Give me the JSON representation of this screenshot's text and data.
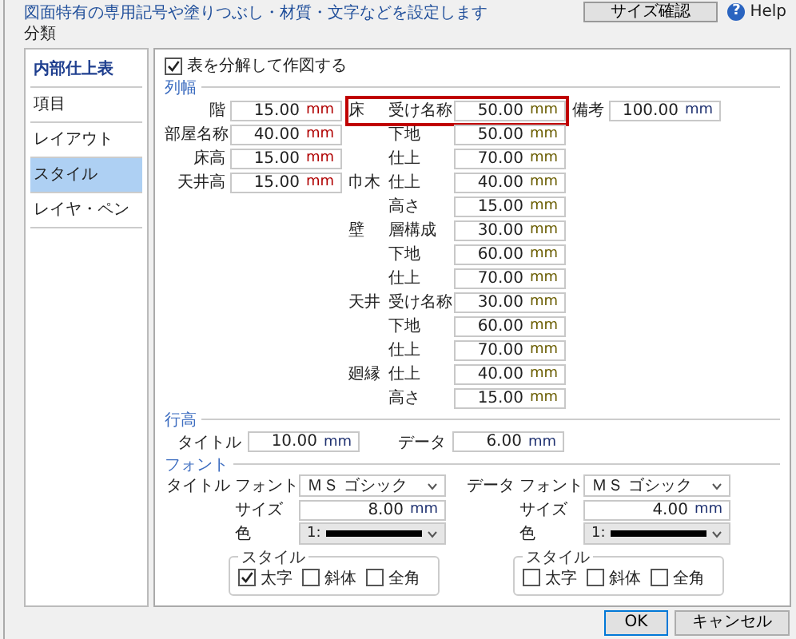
{
  "description": "図面特有の専用記号や塗りつぶし・材質・文字などを設定します",
  "top_button": {
    "label": "サイズ確認"
  },
  "help": {
    "glyph": "?",
    "label": "Help"
  },
  "category_label": "分類",
  "sidebar": {
    "items": [
      {
        "label": "内部仕上表",
        "kind": "header",
        "selected": false
      },
      {
        "label": "項目",
        "kind": "item",
        "selected": false
      },
      {
        "label": "レイアウト",
        "kind": "item",
        "selected": false
      },
      {
        "label": "スタイル",
        "kind": "item",
        "selected": true
      },
      {
        "label": "レイヤ・ペン",
        "kind": "item",
        "selected": false
      }
    ]
  },
  "split_checkbox": {
    "label": "表を分解して作図する",
    "checked": true
  },
  "column_width": {
    "title": "列幅",
    "left": [
      {
        "label": "階",
        "value": "15.00",
        "unit": "mm"
      },
      {
        "label": "部屋名称",
        "value": "40.00",
        "unit": "mm"
      },
      {
        "label": "床高",
        "value": "15.00",
        "unit": "mm"
      },
      {
        "label": "天井高",
        "value": "15.00",
        "unit": "mm"
      }
    ],
    "middle": [
      {
        "group": "床",
        "label": "受け名称",
        "value": "50.00",
        "unit": "mm",
        "highlighted": true
      },
      {
        "label": "下地",
        "value": "50.00",
        "unit": "mm",
        "highlighted": false
      },
      {
        "label": "仕上",
        "value": "70.00",
        "unit": "mm",
        "highlighted": false
      },
      {
        "group": "巾木",
        "label": "仕上",
        "value": "40.00",
        "unit": "mm",
        "highlighted": false
      },
      {
        "label": "高さ",
        "value": "15.00",
        "unit": "mm",
        "highlighted": false
      },
      {
        "group": "壁",
        "label": "層構成",
        "value": "30.00",
        "unit": "mm",
        "highlighted": false
      },
      {
        "label": "下地",
        "value": "60.00",
        "unit": "mm",
        "highlighted": false
      },
      {
        "label": "仕上",
        "value": "70.00",
        "unit": "mm",
        "highlighted": false
      },
      {
        "group": "天井",
        "label": "受け名称",
        "value": "30.00",
        "unit": "mm",
        "highlighted": false
      },
      {
        "label": "下地",
        "value": "60.00",
        "unit": "mm",
        "highlighted": false
      },
      {
        "label": "仕上",
        "value": "70.00",
        "unit": "mm",
        "highlighted": false
      },
      {
        "group": "廻縁",
        "label": "仕上",
        "value": "40.00",
        "unit": "mm",
        "highlighted": false
      },
      {
        "label": "高さ",
        "value": "15.00",
        "unit": "mm",
        "highlighted": false
      }
    ],
    "right": [
      {
        "label": "備考",
        "value": "100.00",
        "unit": "mm"
      }
    ]
  },
  "row_height": {
    "title": "行高",
    "fields": [
      {
        "label": "タイトル",
        "value": "10.00",
        "unit": "mm"
      },
      {
        "label": "データ",
        "value": "6.00",
        "unit": "mm"
      }
    ]
  },
  "font": {
    "title": "フォント",
    "sections": [
      {
        "name": "タイトル",
        "font_label": "フォント",
        "font": "ＭＳ ゴシック",
        "size_label": "サイズ",
        "size": "8.00",
        "unit": "mm",
        "color_label": "色",
        "color_value": "1:",
        "style_title": "スタイル",
        "styles": [
          {
            "label": "太字",
            "checked": true
          },
          {
            "label": "斜体",
            "checked": false
          },
          {
            "label": "全角",
            "checked": false
          }
        ]
      },
      {
        "name": "データ",
        "font_label": "フォント",
        "font": "ＭＳ ゴシック",
        "size_label": "サイズ",
        "size": "4.00",
        "unit": "mm",
        "color_label": "色",
        "color_value": "1:",
        "style_title": "スタイル",
        "styles": [
          {
            "label": "太字",
            "checked": false
          },
          {
            "label": "斜体",
            "checked": false
          },
          {
            "label": "全角",
            "checked": false
          }
        ]
      }
    ]
  },
  "buttons": [
    {
      "label": "OK",
      "kind": "default"
    },
    {
      "label": "キャンセル",
      "kind": "normal"
    }
  ]
}
